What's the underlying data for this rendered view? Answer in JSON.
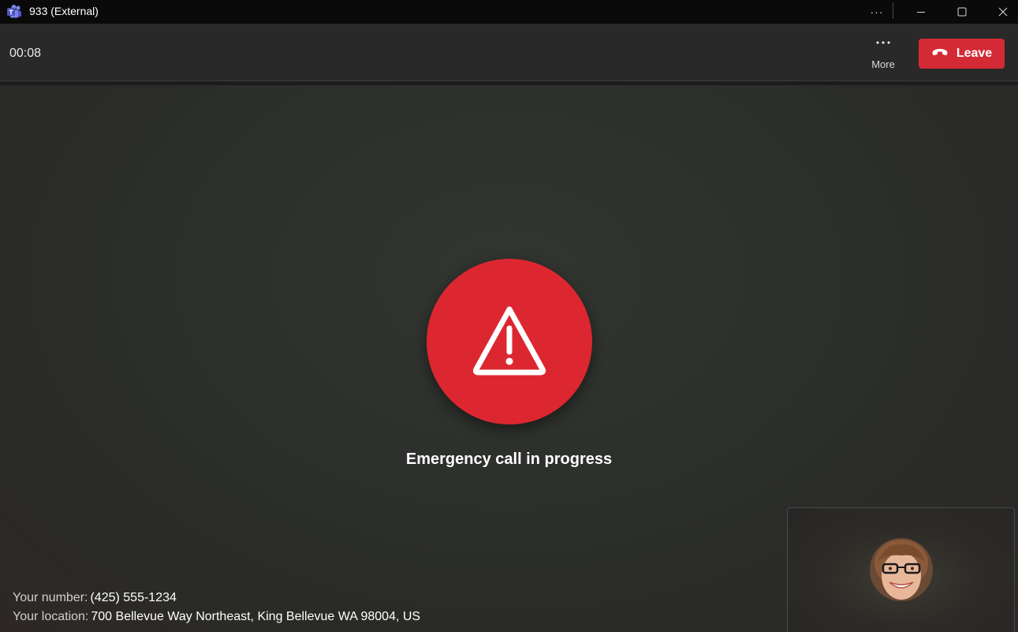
{
  "window": {
    "title": "933 (External)",
    "more_glyph": "···",
    "controls": [
      "minimize",
      "maximize",
      "close"
    ]
  },
  "header": {
    "timer": "00:08",
    "more_label": "More",
    "leave_label": "Leave"
  },
  "call": {
    "status": "Emergency call in progress",
    "number_label": "Your number:",
    "number_value": "(425) 555-1234",
    "location_label": "Your location:",
    "location_value": "700 Bellevue Way Northeast, King Bellevue WA 98004, US"
  },
  "icons": {
    "app": "teams-icon",
    "alert": "warning-triangle-icon",
    "leave": "phone-hangup-icon"
  },
  "colors": {
    "accent_red": "#dc2730",
    "leave_red": "#d42a35",
    "titlebar_bg": "#0a0a0a",
    "header_bg": "#292929"
  }
}
